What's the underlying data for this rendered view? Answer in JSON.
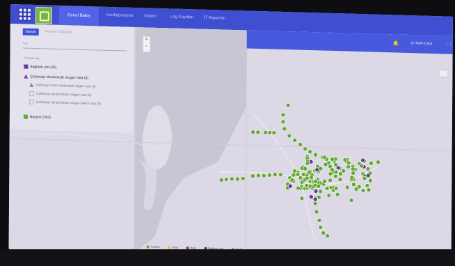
{
  "app": {
    "tabs": [
      {
        "label": "Genel Bakış",
        "active": true
      },
      {
        "label": "Konfigürasyon",
        "active": false
      },
      {
        "label": "Sistem",
        "active": false
      },
      {
        "label": "Log Kayıtları",
        "active": false
      },
      {
        "label": "İT Raporları",
        "active": false
      }
    ],
    "user_label": "Ur Mark Çıkış",
    "more_label": "⋮⋮"
  },
  "panel": {
    "active_tab": "Durum",
    "second_tab": "Konum / Cihazlar",
    "search_placeholder": "Ara",
    "select_all": "Tümünü seç",
    "rows": [
      {
        "label": "Bağlantı yok",
        "count": "(35)",
        "color": "#6b3aa0",
        "kind": "square"
      },
      {
        "label": "Çalışmayı durduracak olugan hata",
        "count": "(4)",
        "color": "#7b3fa0",
        "kind": "triangle"
      },
      {
        "label": "Çalışmayı kimin durdurarak olugan hata",
        "count": "(0)",
        "color": "#8a8a9a",
        "kind": "triangle-sub"
      },
      {
        "label": "Çalışmayı durdurmayan olugan hata",
        "count": "(0)",
        "color": "",
        "kind": "box-sub"
      },
      {
        "label": "Çalışmayı durdurmayan olugan bakım hata",
        "count": "(0)",
        "color": "",
        "kind": "box-sub"
      },
      {
        "label": "Başarılı",
        "count": "(363)",
        "color": "#66a834",
        "kind": "square"
      }
    ]
  },
  "map": {
    "zoom_in": "+",
    "zoom_out": "−",
    "legend": [
      {
        "label": "Tamam",
        "color": "#66a834"
      },
      {
        "label": "Uyarı",
        "color": "#e0c040"
      },
      {
        "label": "Hata",
        "color": "#8b2b8b"
      },
      {
        "label": "Bağlantı yok",
        "color": "#3a3a6a"
      },
      {
        "label": "Seçili",
        "color": "#9b8bb0"
      }
    ],
    "colors": {
      "ok": "#66a834",
      "offline": "#6b3aa0",
      "water": "#c9c7d2",
      "land": "#dcd8e6"
    }
  }
}
